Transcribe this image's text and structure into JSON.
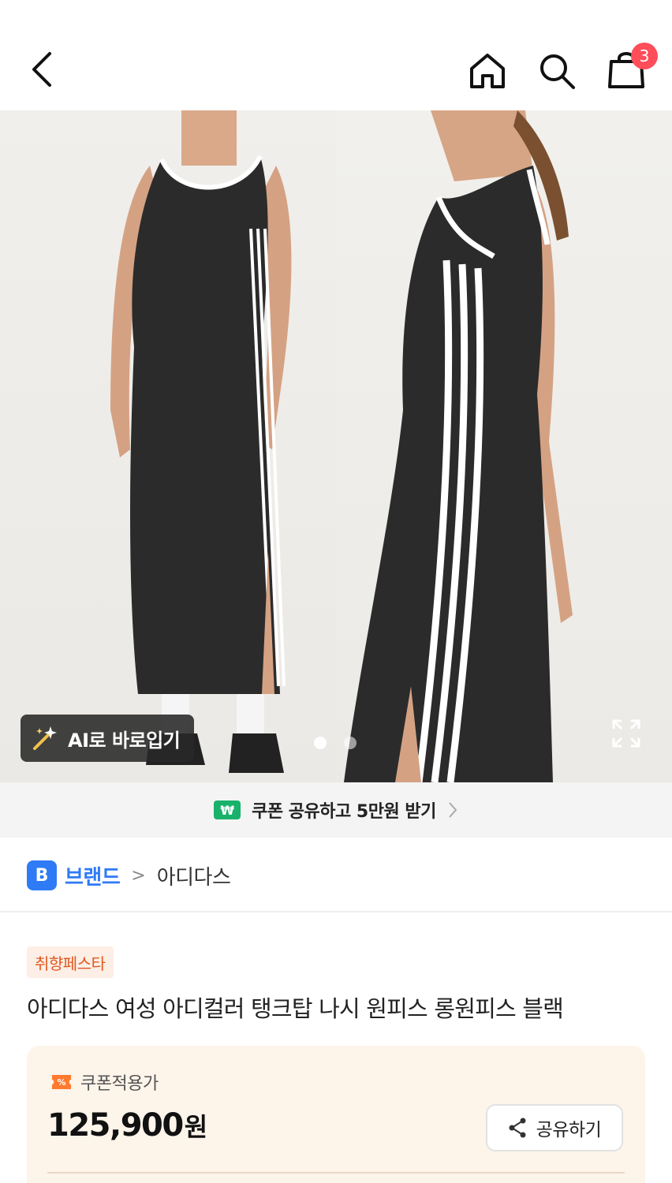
{
  "header": {
    "back_icon": "chevron-left-icon",
    "home_icon": "home-icon",
    "search_icon": "search-icon",
    "cart_icon": "shopping-bag-icon",
    "cart_count": "3"
  },
  "gallery": {
    "ai_try_label": "AI로 바로입기",
    "ai_icon": "magic-wand-icon",
    "expand_icon": "expand-icon",
    "page_count": 2,
    "current_page": 1
  },
  "coupon_banner": {
    "icon_text": "₩",
    "label": "쿠폰 공유하고 5만원 받기"
  },
  "breadcrumb": {
    "badge": "B",
    "brand_link": "브랜드",
    "separator": ">",
    "brand_name": "아디다스"
  },
  "promo_tag": "취향페스타",
  "product_title": "아디다스 여성 아디컬러 탱크탑 나시 원피스 롱원피스 블랙",
  "price": {
    "coupon_label": "쿠폰적용가",
    "value": "125,900",
    "unit": "원",
    "share_label": "공유하기"
  },
  "colors": {
    "accent_blue": "#2f7bf5",
    "badge_red": "#ff4d5a",
    "promo_orange": "#e0591f",
    "coupon_green": "#19b26b"
  }
}
